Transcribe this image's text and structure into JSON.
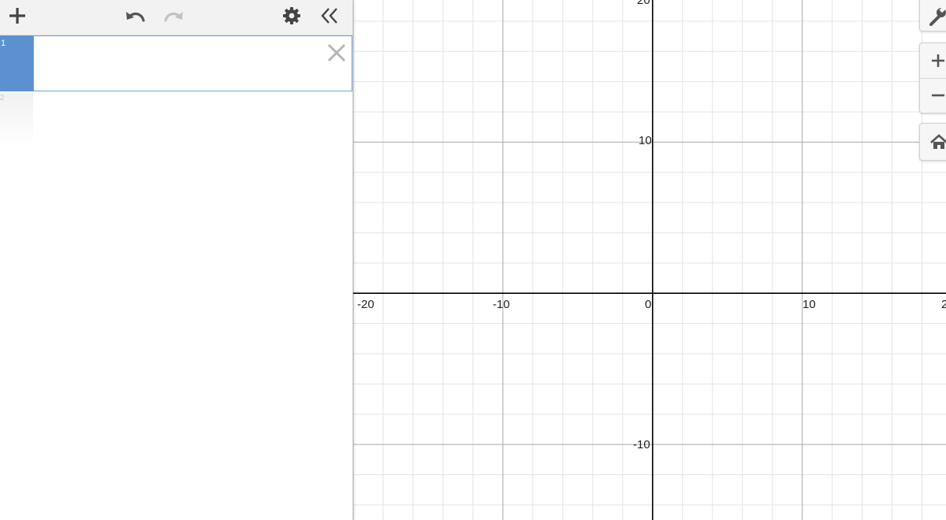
{
  "toolbar": {
    "add_icon": "plus-icon",
    "undo_icon": "undo-icon",
    "redo_icon": "redo-icon",
    "settings_icon": "gear-icon",
    "collapse_icon": "double-chevron-left-icon"
  },
  "expression_list": {
    "items": [
      {
        "index": "1",
        "value": "",
        "color": "#5b91d1"
      }
    ],
    "next_index": "2"
  },
  "graph": {
    "x_ticks": [
      "-20",
      "-10",
      "0",
      "10",
      "2"
    ],
    "y_ticks": [
      "20",
      "10",
      "-10"
    ],
    "x_range": [
      -20,
      19.6
    ],
    "y_range": [
      -15,
      19.4
    ],
    "grid": true,
    "axis_color": "#000000",
    "major_grid_color": "#a9a9a9",
    "minor_grid_color": "#e3e3e3"
  },
  "controls": {
    "wrench_icon": "wrench-icon",
    "zoom_in_icon": "plus-icon",
    "zoom_out_icon": "minus-icon",
    "home_icon": "home-icon"
  },
  "colors": {
    "accent": "#5b91d1",
    "toolbar_bg": "#f2f2f2"
  }
}
